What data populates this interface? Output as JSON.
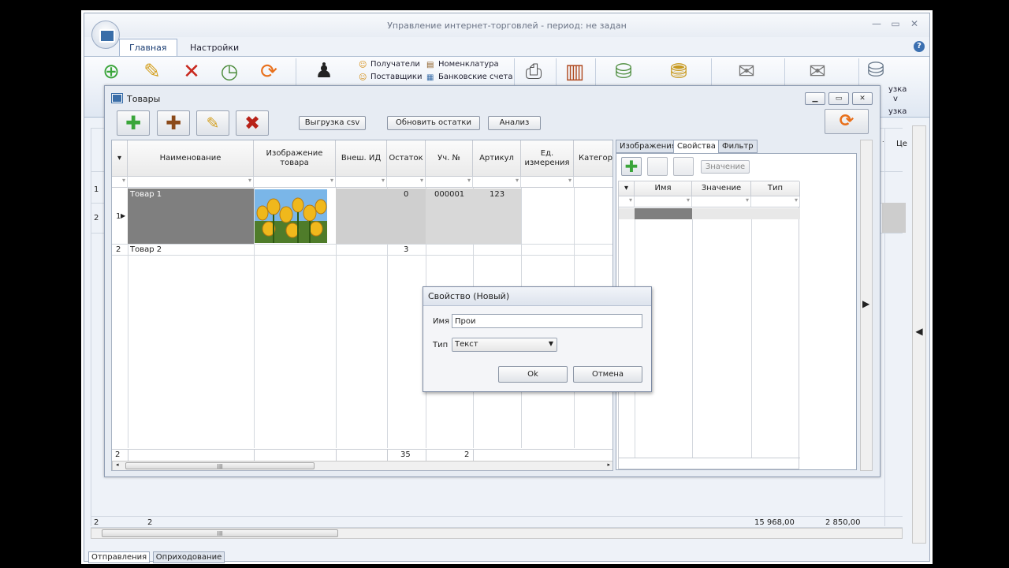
{
  "app": {
    "title": "Управление интернет-торговлей  - период: не задан",
    "tabs": [
      "Главная",
      "Настройки"
    ],
    "ribbon_links": {
      "recipients": "Получатели",
      "suppliers": "Поставщики",
      "nomenclature": "Номенклатура",
      "bank_accounts": "Банковские счета"
    },
    "ribbon_right": [
      "узка",
      "v",
      "узка"
    ],
    "right_col_header": "Це",
    "right_col_header2": "."
  },
  "background_grid": {
    "row_numbers": [
      "1",
      "2"
    ],
    "footer": {
      "count": "2",
      "count2": "2",
      "sum1": "15 968,00",
      "sum2": "2 850,00"
    }
  },
  "bottom_tabs": [
    "Отправления",
    "Оприходование"
  ],
  "goods_window": {
    "title": "Товары",
    "buttons": {
      "export_csv": "Выгрузка csv",
      "update_stock": "Обновить остатки",
      "analysis": "Анализ"
    },
    "columns": [
      "Наименование",
      "Изображение товара",
      "Внеш. ИД",
      "Остаток",
      "Уч. №",
      "Артикул",
      "Ед. измерения",
      "Категор"
    ],
    "rows": [
      {
        "num": "1",
        "name": "Товар 1",
        "stock": "0",
        "account_no": "000001",
        "article": "123"
      },
      {
        "num": "2",
        "name": "Товар 2",
        "stock": "3",
        "account_no": "",
        "article": ""
      }
    ],
    "footer": {
      "count": "2",
      "stock_total": "35",
      "acc_total": "2"
    },
    "scroll_thumb": "III"
  },
  "right_panel": {
    "tabs": [
      "Изображения",
      "Свойства",
      "Фильтр"
    ],
    "value_button": "Значение",
    "columns": [
      "Имя",
      "Значение",
      "Тип"
    ]
  },
  "dialog": {
    "title": "Свойство (Новый)",
    "name_label": "Имя",
    "name_value": "Прои",
    "type_label": "Тип",
    "type_value": "Текст",
    "ok": "Ok",
    "cancel": "Отмена"
  },
  "colors": {
    "selected_row": "#7f7f7f",
    "accent": "#3b6fb0"
  }
}
